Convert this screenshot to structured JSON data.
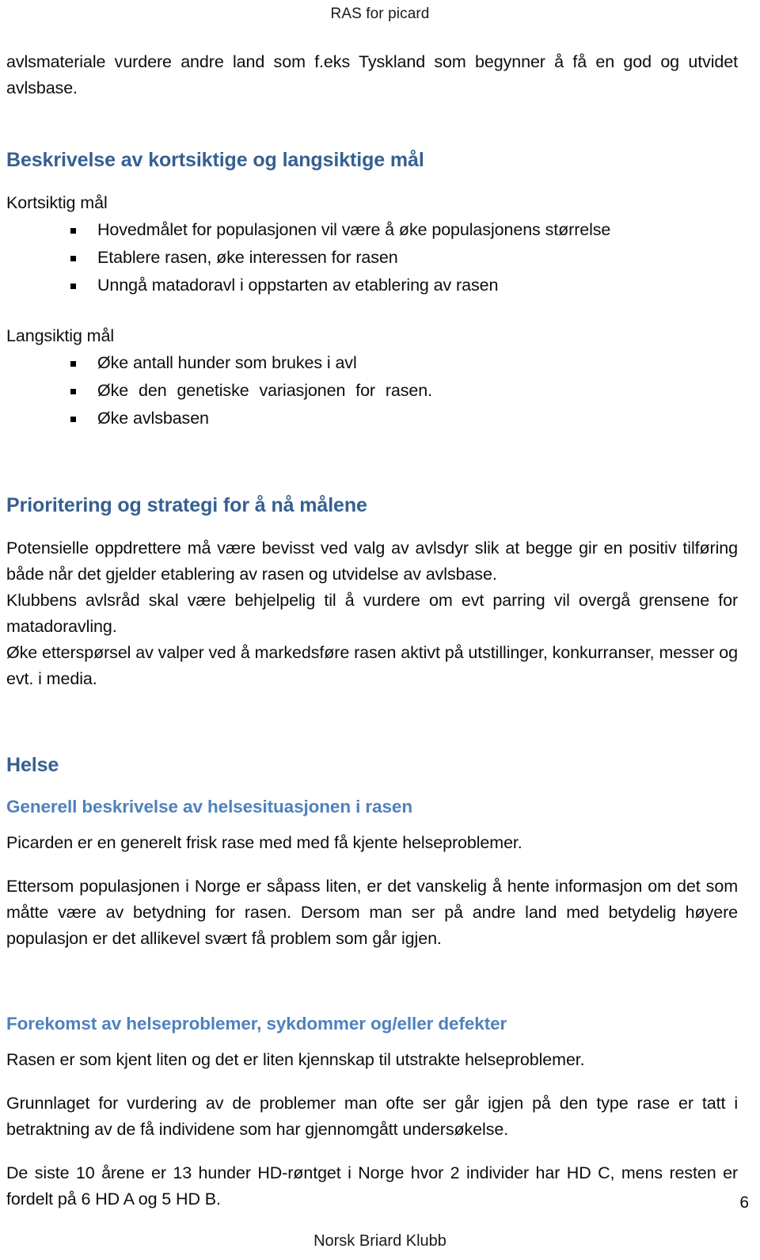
{
  "document": {
    "running_header": "RAS for picard",
    "running_footer": "Norsk Briard Klubb",
    "page_number": "6"
  },
  "content": {
    "intro_paragraph": "avlsmateriale vurdere andre land som f.eks Tyskland som begynner å få en god og utvidet avlsbase.",
    "goals_section": {
      "heading": "Beskrivelse av kortsiktige og langsiktige mål",
      "short_term_label": "Kortsiktig mål",
      "short_term_items": [
        "Hovedmålet for populasjonen vil være å øke populasjonens størrelse",
        "Etablere rasen, øke interessen for rasen",
        "Unngå matadoravl i oppstarten av etablering av rasen"
      ],
      "long_term_label": "Langsiktig mål",
      "long_term_items": [
        "Øke antall hunder som brukes i avl",
        "Øke den genetiske variasjonen for rasen.",
        "Øke avlsbasen"
      ]
    },
    "strategy_section": {
      "heading": "Prioritering og strategi for å nå målene",
      "paragraph_1": "Potensielle oppdrettere må være bevisst ved valg av avlsdyr slik at begge gir en positiv tilføring både når det gjelder etablering av rasen og utvidelse av avlsbase.",
      "paragraph_2": "Klubbens avlsråd skal være behjelpelig til å vurdere om evt parring vil overgå grensene for matadoravling.",
      "paragraph_3": "Øke etterspørsel av valper ved å markedsføre rasen aktivt på utstillinger, konkurranser, messer og evt. i media."
    },
    "health_section": {
      "heading": "Helse",
      "subheading": "Generell beskrivelse av helsesituasjonen i rasen",
      "paragraph_1": "Picarden er en generelt  frisk rase med med få kjente helseproblemer.",
      "paragraph_2": "Ettersom populasjonen i Norge er såpass liten, er det vanskelig å hente informasjon om det som måtte være av betydning for rasen. Dersom man ser på andre land med betydelig høyere populasjon er det allikevel svært få problem som går igjen."
    },
    "problems_section": {
      "heading": "Forekomst av helseproblemer, sykdommer og/eller defekter",
      "paragraph_1": "Rasen er som kjent liten og det er liten kjennskap til utstrakte helseproblemer.",
      "paragraph_2": "Grunnlaget for vurdering av de problemer man ofte ser går igjen på den type rase er tatt i betraktning av de få individene som har gjennomgått undersøkelse.",
      "paragraph_3": "De siste 10 årene er 13 hunder HD-røntget i Norge hvor 2 individer har HD C, mens resten er fordelt på 6 HD A og 5 HD B."
    }
  },
  "colors": {
    "heading_major": "#365F91",
    "heading_sub": "#4F81BD",
    "body_text": "#0D0D0D",
    "page_background": "#FFFFFF"
  }
}
